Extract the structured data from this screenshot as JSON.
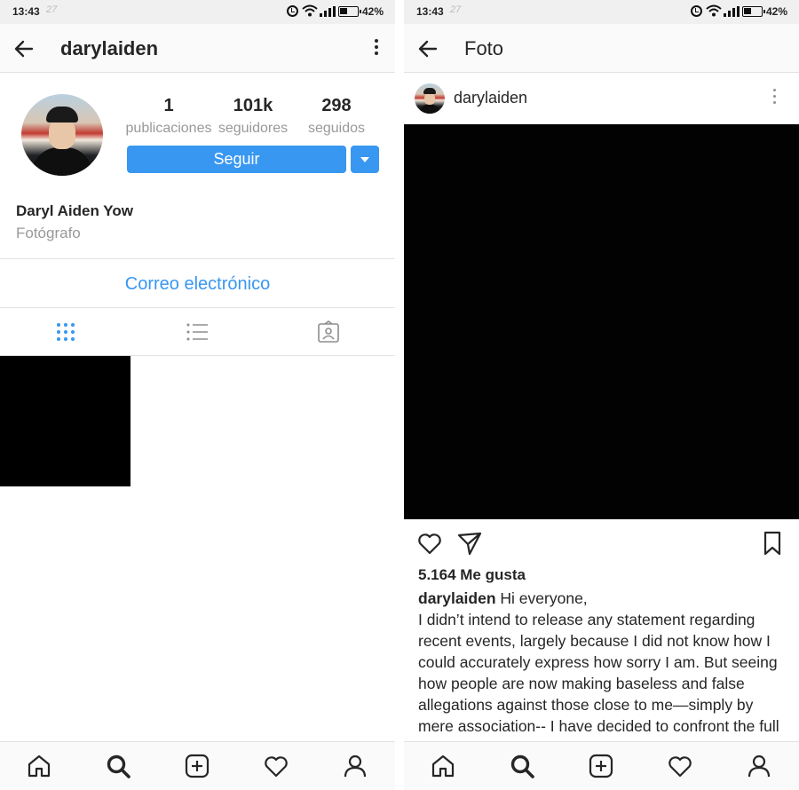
{
  "status_bar": {
    "time": "13:43",
    "notification": "27",
    "battery": "42%"
  },
  "profile_screen": {
    "header": {
      "username": "darylaiden"
    },
    "stats": [
      {
        "value": "1",
        "label": "publicaciones"
      },
      {
        "value": "101k",
        "label": "seguidores"
      },
      {
        "value": "298",
        "label": "seguidos"
      }
    ],
    "follow_label": "Seguir",
    "full_name": "Daryl Aiden Yow",
    "category": "Fotógrafo",
    "contact_label": "Correo electrónico",
    "tabs": [
      "grid-icon",
      "list-icon",
      "tagged-icon"
    ]
  },
  "post_screen": {
    "header": {
      "title": "Foto"
    },
    "post": {
      "username": "darylaiden",
      "likes": "5.164 Me gusta",
      "caption_username": "darylaiden",
      "caption_text": "Hi everyone,\nI didn’t intend to release any statement regarding recent events, largely because I did not know how I could accurately express how sorry I am. But seeing how people are now making baseless and false allegations against those close to me—simply by mere association-- I have decided to confront the full truth of"
    }
  },
  "bottom_nav": [
    "home-icon",
    "search-icon",
    "add-post-icon",
    "activity-icon",
    "profile-icon"
  ],
  "colors": {
    "accent": "#3897f0",
    "text": "#262626",
    "muted": "#999999"
  }
}
